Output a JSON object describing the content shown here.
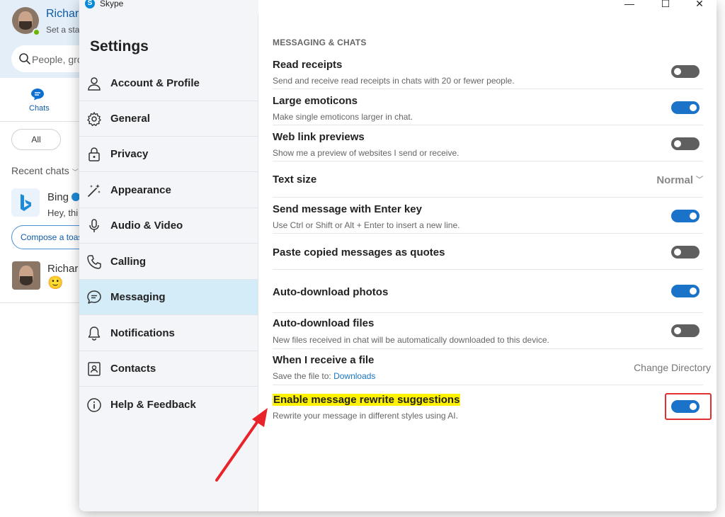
{
  "background": {
    "user_name": "Richar",
    "status_text": "Set a sta",
    "search_placeholder": "People, gro",
    "chats_tab": "Chats",
    "filter_all": "All",
    "recent_chats": "Recent chats",
    "bing_name": "Bing",
    "bing_preview": "Hey, thi",
    "compose_button": "Compose a toas",
    "richard_name": "Richar",
    "richard_preview": "🙂"
  },
  "window": {
    "app_name": "Skype",
    "minimize": "—",
    "maximize": "☐",
    "close": "✕"
  },
  "sidebar": {
    "title": "Settings",
    "items": [
      {
        "label": "Account & Profile",
        "icon": "person-icon"
      },
      {
        "label": "General",
        "icon": "gear-icon"
      },
      {
        "label": "Privacy",
        "icon": "lock-icon"
      },
      {
        "label": "Appearance",
        "icon": "magic-wand-icon"
      },
      {
        "label": "Audio & Video",
        "icon": "microphone-icon"
      },
      {
        "label": "Calling",
        "icon": "phone-icon"
      },
      {
        "label": "Messaging",
        "icon": "chat-bubble-icon"
      },
      {
        "label": "Notifications",
        "icon": "bell-icon"
      },
      {
        "label": "Contacts",
        "icon": "contact-card-icon"
      },
      {
        "label": "Help & Feedback",
        "icon": "info-icon"
      }
    ],
    "active_item": "Messaging"
  },
  "content": {
    "section_header": "MESSAGING & CHATS",
    "settings": [
      {
        "title": "Read receipts",
        "description": "Send and receive read receipts in chats with 20 or fewer people.",
        "control": "toggle",
        "enabled": false
      },
      {
        "title": "Large emoticons",
        "description": "Make single emoticons larger in chat.",
        "control": "toggle",
        "enabled": true
      },
      {
        "title": "Web link previews",
        "description": "Show me a preview of websites I send or receive.",
        "control": "toggle",
        "enabled": false
      },
      {
        "title": "Text size",
        "control": "dropdown",
        "value": "Normal"
      },
      {
        "title": "Send message with Enter key",
        "description": "Use Ctrl or Shift or Alt + Enter to insert a new line.",
        "control": "toggle",
        "enabled": true
      },
      {
        "title": "Paste copied messages as quotes",
        "control": "toggle",
        "enabled": false
      },
      {
        "title": "Auto-download photos",
        "control": "toggle",
        "enabled": true
      },
      {
        "title": "Auto-download files",
        "description": "New files received in chat will be automatically downloaded to this device.",
        "control": "toggle",
        "enabled": false
      },
      {
        "title": "When I receive a file",
        "description_prefix": "Save the file to: ",
        "description_link": "Downloads",
        "control": "button",
        "button_label": "Change Directory"
      },
      {
        "title": "Enable message rewrite suggestions",
        "description": "Rewrite your message in different styles using AI.",
        "control": "toggle",
        "enabled": true,
        "highlighted": true
      }
    ]
  },
  "colors": {
    "accent": "#1a73c8",
    "toggle_off": "#5f5f5f",
    "highlight": "#fff200",
    "annotation": "#e03030",
    "active_nav": "#d4ebf8"
  }
}
